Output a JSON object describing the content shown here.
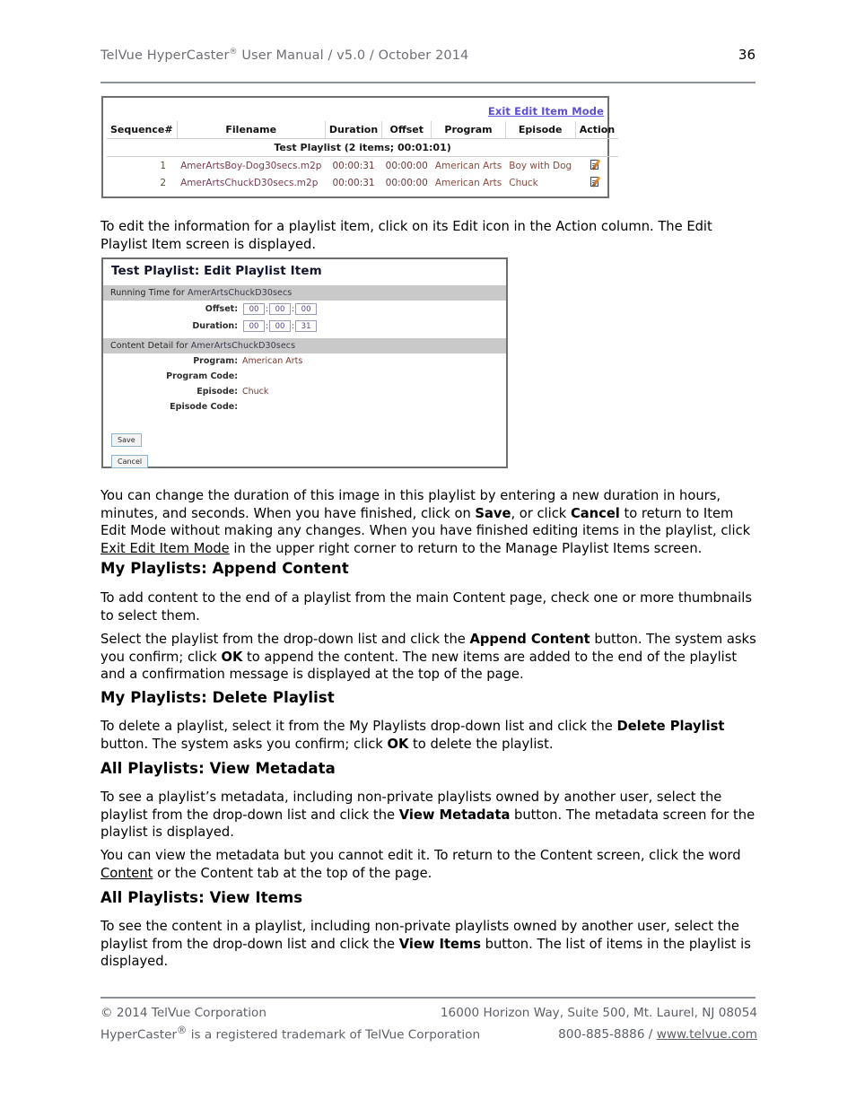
{
  "header": {
    "title_pre": "TelVue HyperCaster",
    "title_sup": "®",
    "title_post": " User Manual  / v5.0 / October 2014",
    "page_number": "36"
  },
  "figure1": {
    "exit_link": "Exit Edit Item Mode",
    "playlist_title": "Test Playlist (2 items; 00:01:01)",
    "columns": [
      "Sequence#",
      "Filename",
      "Duration",
      "Offset",
      "Program",
      "Episode",
      "Action"
    ],
    "rows": [
      {
        "sequence": "1",
        "filename": "AmerArtsBoy-Dog30secs.m2p",
        "duration": "00:00:31",
        "offset": "00:00:00",
        "program": "American Arts",
        "episode": "Boy with Dog",
        "action_icon": "edit-icon"
      },
      {
        "sequence": "2",
        "filename": "AmerArtsChuckD30secs.m2p",
        "duration": "00:00:31",
        "offset": "00:00:00",
        "program": "American Arts",
        "episode": "Chuck",
        "action_icon": "edit-icon"
      }
    ]
  },
  "figure2": {
    "title": "Test Playlist: Edit Playlist Item",
    "running_time_band_label": "Running Time for ",
    "running_time_band_file": "AmerArtsChuckD30secs",
    "offset_label": "Offset:",
    "offset_hours": "00",
    "offset_minutes": "00",
    "offset_seconds": "00",
    "duration_label": "Duration:",
    "duration_hours": "00",
    "duration_minutes": "00",
    "duration_seconds": "31",
    "content_detail_band_label": "Content Detail for ",
    "content_detail_band_file": "AmerArtsChuckD30secs",
    "program_label": "Program:",
    "program_value": "American Arts",
    "program_code_label": "Program Code:",
    "program_code_value": "",
    "episode_label": "Episode:",
    "episode_value": "Chuck",
    "episode_code_label": "Episode Code:",
    "episode_code_value": "",
    "save_button": "Save",
    "cancel_button": "Cancel"
  },
  "body": {
    "p_edit_info_1": "To edit the information for a playlist item, click on its Edit icon in the Action column. The Edit Playlist",
    "p_edit_info_2": "Item screen is displayed.",
    "p_duration_a": "You can change the duration of this image in this playlist by entering a new duration in hours, minutes, and seconds. When you have finished, click on ",
    "p_duration_save": "Save",
    "p_duration_b": ", or click ",
    "p_duration_cancel": "Cancel",
    "p_duration_c": " to return to Item Edit Mode without making any changes. When you have finished editing items in the playlist, click ",
    "p_duration_link": "Exit Edit Item Mode",
    "p_duration_d": " in the upper right corner to return to the Manage Playlist Items screen."
  },
  "sections": [
    {
      "heading": "My Playlists: Append Content",
      "paragraphs": [
        {
          "a": "To add content to the end of a playlist from the main Content page, check one or more thumbnails to select them."
        },
        {
          "a": "Select the playlist from the drop-down list and click the ",
          "bold1": "Append Content",
          "b": " button.  The system asks you confirm; click ",
          "bold2": "OK",
          "c": " to append the content. The new items are added to the end of the playlist and a confirmation message is displayed at the top of the page."
        }
      ]
    },
    {
      "heading": "My Playlists: Delete Playlist",
      "paragraphs": [
        {
          "a": "To delete a playlist, select it from the My Playlists drop-down list and click the ",
          "bold1": "Delete Playlist",
          "b": " button. The system asks you confirm; click ",
          "bold2": "OK",
          "c": " to delete the playlist."
        }
      ]
    },
    {
      "heading": "All Playlists: View Metadata",
      "paragraphs": [
        {
          "a": "To see a playlist’s metadata, including non-private playlists owned by another user, select the playlist from the drop-down list and click the ",
          "bold1": "View Metadata",
          "b": " button. The metadata screen for the playlist is displayed."
        },
        {
          "a": "You can view the metadata but you cannot edit it. To return to the Content screen, click the word ",
          "link1": "Content",
          "b": " or the Content tab at the top of the page."
        }
      ]
    },
    {
      "heading": "All Playlists: View Items",
      "paragraphs": [
        {
          "a": "To see the content in a playlist, including non-private playlists owned by another user, select the playlist from the drop-down list and click the ",
          "bold1": "View Items",
          "b": " button. The list of items in the playlist is displayed."
        }
      ]
    }
  ],
  "footer": {
    "copyright": "© 2014 TelVue Corporation",
    "address": "16000 Horizon Way, Suite 500, Mt. Laurel, NJ 08054",
    "trademark_pre": "HyperCaster",
    "trademark_sup": "®",
    "trademark_post": " is a registered trademark of TelVue Corporation",
    "phone": "800-885-8886",
    "separator": " / ",
    "website": "www.telvue.com"
  },
  "colors": {
    "rule": "#8c919a",
    "header_text": "#6d6f74",
    "link": "#5b4fcf",
    "band": "#c9c9c9",
    "figure_border": "#6e6e6e"
  }
}
